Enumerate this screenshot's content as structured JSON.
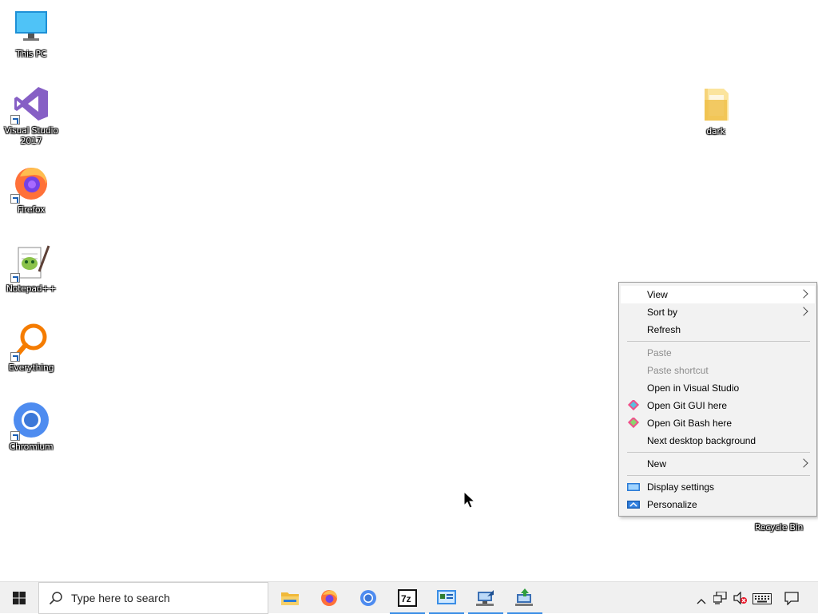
{
  "desktop": {
    "icons": [
      {
        "label": "This PC",
        "icon": "this-pc-icon"
      },
      {
        "label": "Visual Studio 2017",
        "icon": "visual-studio-icon"
      },
      {
        "label": "Firefox",
        "icon": "firefox-icon"
      },
      {
        "label": "Notepad++",
        "icon": "notepad-plus-plus-icon"
      },
      {
        "label": "Everything",
        "icon": "everything-icon"
      },
      {
        "label": "Chromium",
        "icon": "chromium-icon"
      },
      {
        "label": "dark",
        "icon": "folder-icon"
      },
      {
        "label": "Recycle Bin",
        "icon": "recycle-bin-icon"
      }
    ]
  },
  "context_menu": {
    "items": [
      {
        "label": "View",
        "submenu": true,
        "state": "hover"
      },
      {
        "label": "Sort by",
        "submenu": true
      },
      {
        "label": "Refresh"
      },
      {
        "label": "Paste",
        "disabled": true
      },
      {
        "label": "Paste shortcut",
        "disabled": true
      },
      {
        "label": "Open in Visual Studio"
      },
      {
        "label": "Open Git GUI here",
        "icon": "git-icon"
      },
      {
        "label": "Open Git Bash here",
        "icon": "git-icon"
      },
      {
        "label": "Next desktop background"
      },
      {
        "label": "New",
        "submenu": true
      },
      {
        "label": "Display settings",
        "icon": "display-icon"
      },
      {
        "label": "Personalize",
        "icon": "personalize-icon"
      }
    ]
  },
  "taskbar": {
    "search_placeholder": "Type here to search",
    "apps": [
      "file-explorer-icon",
      "firefox-icon",
      "chromium-icon",
      "7zip-icon",
      "control-panel-icon",
      "network-tool-icon",
      "network-upload-icon"
    ],
    "tray": [
      "chevron-up-icon",
      "network-icon",
      "volume-muted-icon",
      "keyboard-icon",
      "notification-icon"
    ]
  },
  "colors": {
    "accent": "#3a8ee6",
    "menu_bg": "#f2f2f2",
    "taskbar_bg": "#f0f0f0"
  }
}
